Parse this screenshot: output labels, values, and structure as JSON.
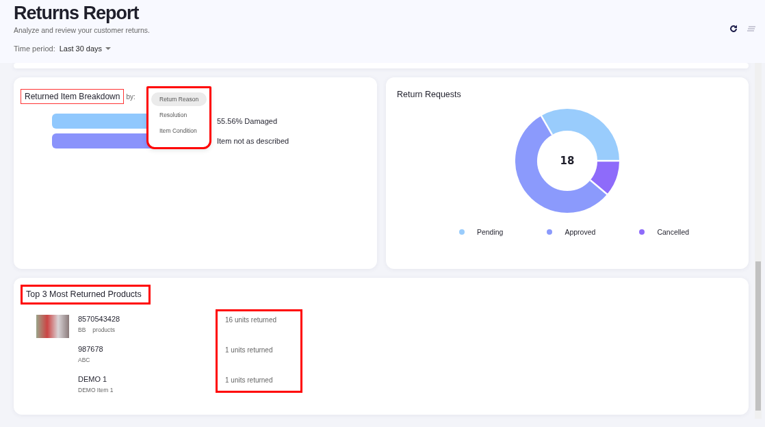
{
  "header": {
    "title": "Returns Report",
    "subtitle": "Analyze and review your customer returns.",
    "time_period": {
      "label": "Time period:",
      "value": "Last 30 days"
    }
  },
  "breakdown": {
    "title": "Returned Item Breakdown",
    "by_label": "by:",
    "bars": [
      {
        "label": "55.56% Damaged",
        "color": "#90c8fd"
      },
      {
        "label": "Item not as described",
        "color": "#8a93fb"
      }
    ],
    "menu": [
      {
        "label": "Return Reason",
        "selected": true
      },
      {
        "label": "Resolution",
        "selected": false
      },
      {
        "label": "Item Condition",
        "selected": false
      }
    ]
  },
  "requests": {
    "title": "Return Requests",
    "total": "18",
    "legend": [
      {
        "label": "Pending",
        "color": "#99ccfc"
      },
      {
        "label": "Approved",
        "color": "#8b9afc"
      },
      {
        "label": "Cancelled",
        "color": "#8e6bfa"
      }
    ]
  },
  "top_products": {
    "title": "Top 3 Most Returned Products",
    "products": [
      {
        "name": "8570543428",
        "details": [
          "BB",
          "products"
        ],
        "units": "16 units returned",
        "photo": true
      },
      {
        "name": "987678",
        "details": [
          "ABC"
        ],
        "units": "1 units returned",
        "photo": false
      },
      {
        "name": "DEMO 1",
        "details": [
          "DEMO Item 1"
        ],
        "units": "1 units returned",
        "photo": false
      }
    ]
  }
}
